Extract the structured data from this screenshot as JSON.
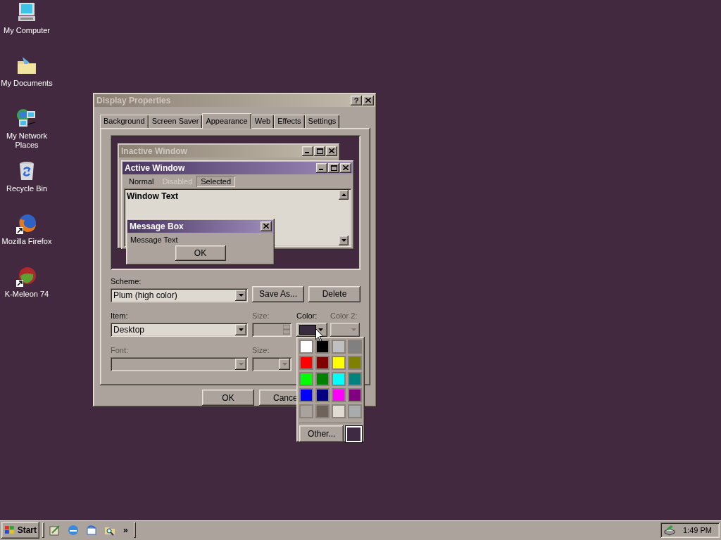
{
  "desktop_icons": [
    {
      "label": "My Computer",
      "kind": "computer"
    },
    {
      "label": "My Documents",
      "kind": "documents"
    },
    {
      "label": "My Network Places",
      "kind": "network"
    },
    {
      "label": "Recycle Bin",
      "kind": "bin"
    },
    {
      "label": "Mozilla Firefox",
      "kind": "firefox"
    },
    {
      "label": "K-Meleon 74",
      "kind": "meleon"
    }
  ],
  "dialog": {
    "title": "Display Properties",
    "help": "?",
    "tabs": [
      {
        "label": "Background",
        "selected": false
      },
      {
        "label": "Screen Saver",
        "selected": false
      },
      {
        "label": "Appearance",
        "selected": true
      },
      {
        "label": "Web",
        "selected": false
      },
      {
        "label": "Effects",
        "selected": false
      },
      {
        "label": "Settings",
        "selected": false
      }
    ],
    "preview": {
      "inactive_title": "Inactive Window",
      "active_title": "Active Window",
      "menu": [
        {
          "label": "Normal",
          "disabled": false,
          "selected": false
        },
        {
          "label": "Disabled",
          "disabled": true,
          "selected": false
        },
        {
          "label": "Selected",
          "disabled": false,
          "selected": true
        }
      ],
      "window_text": "Window Text",
      "message_box": {
        "title": "Message Box",
        "text": "Message Text",
        "button": "OK"
      }
    },
    "scheme": {
      "label": "Scheme:",
      "value": "Plum (high color)",
      "buttons": [
        "Save As...",
        "Delete"
      ]
    },
    "item": {
      "label": "Item:",
      "value": "Desktop"
    },
    "item_size": {
      "label": "Size:",
      "disabled": true
    },
    "color": {
      "label": "Color:",
      "color": "#3a2c40"
    },
    "color2": {
      "label": "Color 2:",
      "disabled": true
    },
    "font": {
      "label": "Font:",
      "disabled": true
    },
    "font_size": {
      "label": "Size:",
      "disabled": true
    },
    "buttons": [
      {
        "label": "OK",
        "cut": false
      },
      {
        "label": "Cance",
        "cut": true
      }
    ]
  },
  "color_menu": {
    "swatches": [
      {
        "color": "#ffffff",
        "selected": false
      },
      {
        "color": "#000000",
        "selected": false
      },
      {
        "color": "#c0c0c0",
        "selected": false
      },
      {
        "color": "#808080",
        "selected": false
      },
      {
        "color": "#ff0000",
        "selected": false
      },
      {
        "color": "#800000",
        "selected": false
      },
      {
        "color": "#ffff00",
        "selected": false
      },
      {
        "color": "#808000",
        "selected": false
      },
      {
        "color": "#00ff00",
        "selected": false
      },
      {
        "color": "#008000",
        "selected": false
      },
      {
        "color": "#00ffff",
        "selected": false
      },
      {
        "color": "#008080",
        "selected": false
      },
      {
        "color": "#0000ff",
        "selected": false
      },
      {
        "color": "#000080",
        "selected": false
      },
      {
        "color": "#ff00ff",
        "selected": false
      },
      {
        "color": "#800080",
        "selected": false
      },
      {
        "color": "#aaa29c",
        "selected": false
      },
      {
        "color": "#6e625b",
        "selected": false
      },
      {
        "color": "#e0dcd4",
        "selected": false
      },
      {
        "color": "#a8acac",
        "selected": false
      }
    ],
    "other": "Other...",
    "current": {
      "color": "#3f2a44",
      "selected": true
    }
  },
  "taskbar": {
    "start": "Start",
    "quick_launch": [
      {
        "kind": "desktop"
      },
      {
        "kind": "browser"
      },
      {
        "kind": "mail"
      },
      {
        "kind": "search"
      }
    ],
    "more": "»",
    "clock": "1:49 PM"
  }
}
